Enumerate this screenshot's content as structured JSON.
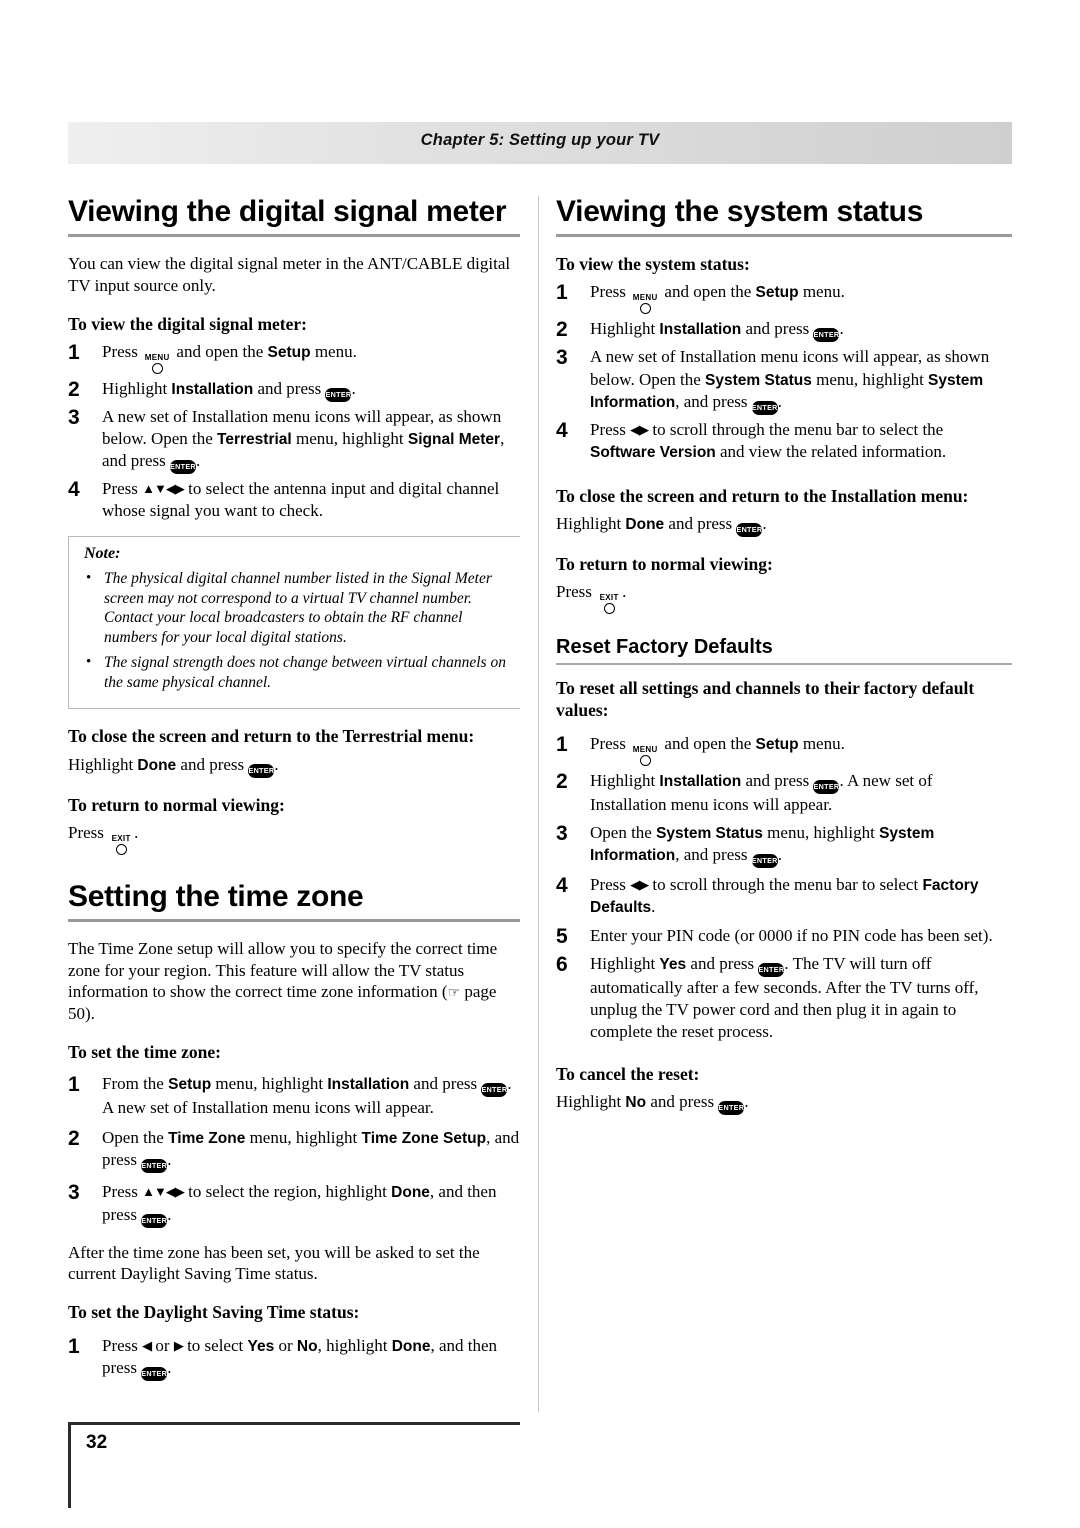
{
  "header": {
    "chapter": "Chapter 5: Setting up your TV"
  },
  "page": {
    "number": "32"
  },
  "keys": {
    "menu": "MENU",
    "exit": "EXIT",
    "enter": "ENTER"
  },
  "left": {
    "section1": {
      "title": "Viewing the digital signal meter",
      "intro": "You can view the digital signal meter in the ANT/CABLE digital TV input source only.",
      "sub1": "To view the digital signal meter:",
      "steps": [
        {
          "n": "1",
          "parts": [
            "Press ",
            "KEY_MENU",
            " and open the ",
            "Setup",
            " menu."
          ]
        },
        {
          "n": "2",
          "parts": [
            "Highlight ",
            "Installation",
            " and press ",
            "KEY_ENTER",
            "."
          ]
        },
        {
          "n": "3",
          "parts": [
            "A new set of Installation menu icons will appear, as shown below. Open the ",
            "Terrestrial",
            " menu, highlight ",
            "Signal Meter",
            ", and press ",
            "KEY_ENTER",
            "."
          ]
        },
        {
          "n": "4",
          "parts": [
            "Press ",
            "ARROWS4",
            " to select the antenna input and digital channel whose signal you want to check."
          ]
        }
      ],
      "note": {
        "title": "Note:",
        "items": [
          "The physical digital channel number listed in the Signal Meter screen may not correspond to a virtual TV channel number. Contact your local broadcasters to obtain the RF channel numbers for your local digital stations.",
          "The signal strength does not change between virtual channels on the same physical channel."
        ]
      },
      "close_heading": "To close the screen and return to the Terrestrial menu:",
      "close_line": [
        "Highlight ",
        "Done",
        " and press ",
        "KEY_ENTER",
        "."
      ],
      "return_heading": "To return to normal viewing:",
      "return_line": [
        "Press ",
        "KEY_EXIT",
        "."
      ]
    },
    "section2": {
      "title": "Setting the time zone",
      "intro": "The Time Zone setup will allow you to specify the correct time zone for your region. This feature will allow the TV status information to show the correct time zone information (",
      "intro_ref": " page 50).",
      "sub1": "To set the time zone:",
      "steps": [
        {
          "n": "1",
          "parts": [
            "From the ",
            "Setup",
            " menu, highlight ",
            "Installation",
            " and press ",
            "KEY_ENTER",
            ". A new set of Installation menu icons will appear."
          ]
        },
        {
          "n": "2",
          "parts": [
            "Open the ",
            "Time Zone",
            " menu, highlight ",
            "Time Zone Setup",
            ", and press ",
            "KEY_ENTER",
            "."
          ]
        },
        {
          "n": "3",
          "parts": [
            "Press ",
            "ARROWS4",
            " to select the region, highlight ",
            "Done",
            ", and then press ",
            "KEY_ENTER",
            "."
          ]
        }
      ],
      "after": "After the time zone has been set, you will be asked to set the current Daylight Saving Time status.",
      "sub2": "To set the Daylight Saving Time status:",
      "steps2": [
        {
          "n": "1",
          "parts": [
            "Press ",
            "ARROW_LEFT",
            " or ",
            "ARROW_RIGHT",
            " to select ",
            "Yes",
            " or ",
            "No",
            ", highlight ",
            "Done",
            ", and then press ",
            "KEY_ENTER",
            "."
          ]
        }
      ]
    }
  },
  "right": {
    "section1": {
      "title": "Viewing the system status",
      "sub1": "To view the system status:",
      "steps": [
        {
          "n": "1",
          "parts": [
            "Press ",
            "KEY_MENU",
            " and open the ",
            "Setup",
            " menu."
          ]
        },
        {
          "n": "2",
          "parts": [
            "Highlight ",
            "Installation",
            " and press ",
            "KEY_ENTER",
            "."
          ]
        },
        {
          "n": "3",
          "parts": [
            "A new set of Installation menu icons will appear, as shown below. Open the ",
            "System Status",
            " menu, highlight ",
            "System Information",
            ", and press ",
            "KEY_ENTER",
            "."
          ]
        },
        {
          "n": "4",
          "parts": [
            "Press ",
            "ARROWS_LR",
            " to scroll through the menu bar to select the ",
            "Software Version",
            " and view the related information."
          ]
        }
      ],
      "close_heading": "To close the screen and return to the Installation menu:",
      "close_line": [
        "Highlight ",
        "Done",
        " and press ",
        "KEY_ENTER",
        "."
      ],
      "return_heading": "To return to normal viewing:",
      "return_line": [
        "Press ",
        "KEY_EXIT",
        "."
      ]
    },
    "section2": {
      "title": "Reset Factory Defaults",
      "sub1": "To reset all settings and channels to their factory default values:",
      "steps": [
        {
          "n": "1",
          "parts": [
            "Press ",
            "KEY_MENU",
            " and open the ",
            "Setup",
            " menu."
          ]
        },
        {
          "n": "2",
          "parts": [
            "Highlight ",
            "Installation",
            " and press ",
            "KEY_ENTER",
            ". A new set of Installation menu icons will appear."
          ]
        },
        {
          "n": "3",
          "parts": [
            "Open the ",
            "System Status",
            " menu, highlight ",
            "System Information",
            ", and press ",
            "KEY_ENTER",
            "."
          ]
        },
        {
          "n": "4",
          "parts": [
            "Press ",
            "ARROWS_LR",
            " to scroll through the menu bar to select ",
            "Factory Defaults",
            "."
          ]
        },
        {
          "n": "5",
          "parts": [
            "Enter your PIN code (or 0000 if no PIN code has been set)."
          ]
        },
        {
          "n": "6",
          "parts": [
            "Highlight ",
            "Yes",
            " and press ",
            "KEY_ENTER",
            ". The TV will turn off automatically after a few seconds. After the TV turns off, unplug the TV power cord and then plug it in again to complete the reset process."
          ]
        }
      ],
      "cancel_heading": "To cancel the reset:",
      "cancel_line": [
        "Highlight ",
        "No",
        " and press ",
        "KEY_ENTER",
        "."
      ]
    }
  }
}
